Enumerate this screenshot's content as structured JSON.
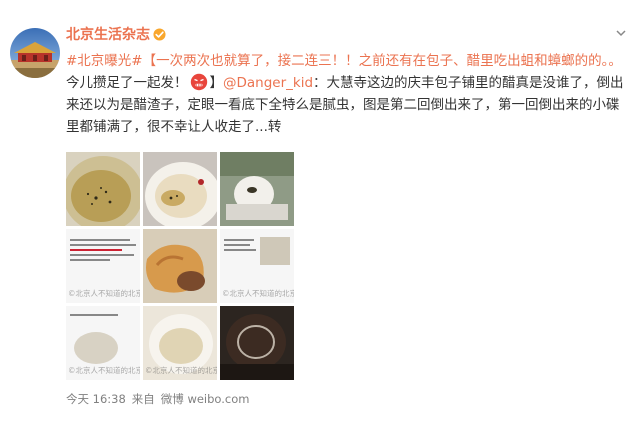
{
  "header": {
    "account_name": "北京生活杂志",
    "verified_icon": "verified-badge-icon",
    "menu_icon": "chevron-down-icon"
  },
  "post": {
    "topic": "#北京曝光#",
    "highlight": "【一次两次也就算了，接二连三！！之前还有在包子、醋里吃出蛆和蟑螂的的。。",
    "text_a": "今儿攒足了一起发！",
    "emoji_icon": "angry-face-emoji-icon",
    "bracket_close": "】",
    "mention": "@Danger_kid",
    "body": "：大慧寺这边的庆丰包子铺里的醋真是没谁了，倒出来还以为是醋渣子，定眼一看底下全特么是腻虫，图是第二回倒出来了，第一回倒出来的小碟里都铺满了，很不幸让人收走了...",
    "forward": "转"
  },
  "images": {
    "watermarks": [
      "©北京人不知道的北京",
      "©北京人不知道的北京",
      "©北京人不知道的北京",
      "©北京人不知道的北京"
    ]
  },
  "footer": {
    "time": "今天 16:38",
    "source_prefix": "来自",
    "app": "微博 weibo.com"
  },
  "colors": {
    "link": "#eb7350",
    "text": "#333333",
    "meta": "#808080"
  }
}
